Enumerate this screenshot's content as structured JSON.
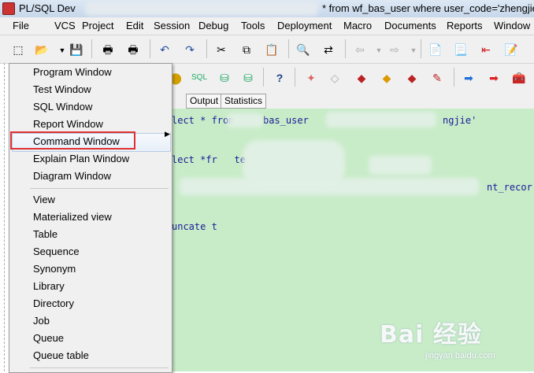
{
  "titlebar": {
    "title_left": "PL/SQL Dev",
    "title_right": "* from wf_bas_user where user_code='zhengjie"
  },
  "menubar": {
    "items": [
      "File",
      "VCS",
      "Project",
      "Edit",
      "Session",
      "Debug",
      "Tools",
      "Deployment",
      "Macro",
      "Documents",
      "Reports",
      "Window"
    ]
  },
  "tabs": [
    "Output",
    "Statistics"
  ],
  "editor": {
    "line1_a": "lect * from",
    "line1_b": "bas_user",
    "line1_c": "ngjie'",
    "line2": "lect *fr   te",
    "line3": "nt_recor",
    "line4": "uncate t"
  },
  "dropdown": {
    "items": [
      "Program Window",
      "Test Window",
      "SQL Window",
      "Report Window",
      "Command Window",
      "Explain Plan Window",
      "Diagram Window",
      "View",
      "Materialized view",
      "Table",
      "Sequence",
      "Synonym",
      "Library",
      "Directory",
      "Job",
      "Queue",
      "Queue table"
    ]
  },
  "watermark": {
    "brand": "Bai 经验",
    "url": "jingyan.baidu.com"
  },
  "colors": {
    "editor_bg": "#c8ecc8",
    "highlight_border": "#e03030"
  }
}
